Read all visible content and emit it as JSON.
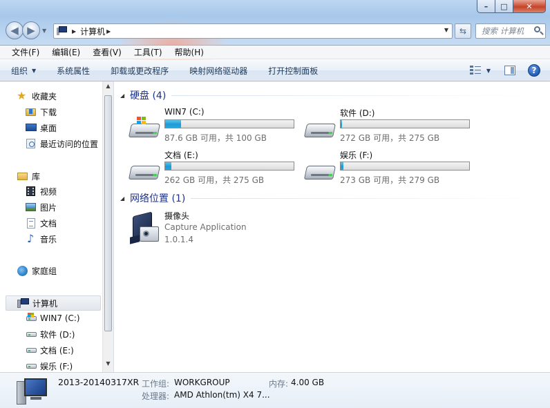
{
  "window": {
    "minimize_glyph": "–",
    "maximize_glyph": "□",
    "close_glyph": "✕"
  },
  "nav": {
    "back_glyph": "◀",
    "forward_glyph": "▶"
  },
  "address": {
    "path": "计算机",
    "separator_glyph": "▶"
  },
  "search": {
    "placeholder": "搜索 计算机"
  },
  "menu": [
    "文件(F)",
    "编辑(E)",
    "查看(V)",
    "工具(T)",
    "帮助(H)"
  ],
  "commands": {
    "organize": "组织",
    "system_properties": "系统属性",
    "uninstall": "卸载或更改程序",
    "map_drive": "映射网络驱动器",
    "control_panel": "打开控制面板",
    "help_glyph": "?"
  },
  "sidebar": {
    "favorites": {
      "label": "收藏夹",
      "items": [
        "下载",
        "桌面",
        "最近访问的位置"
      ]
    },
    "libraries": {
      "label": "库",
      "items": [
        "视频",
        "图片",
        "文档",
        "音乐"
      ]
    },
    "homegroup": "家庭组",
    "computer": {
      "label": "计算机",
      "items": [
        "WIN7 (C:)",
        "软件 (D:)",
        "文档 (E:)",
        "娱乐 (F:)"
      ]
    }
  },
  "drives_group": {
    "title": "硬盘 (4)",
    "drives": [
      {
        "name": "WIN7 (C:)",
        "free_text": "87.6 GB 可用，共 100 GB",
        "used_percent": 12.4,
        "system": true
      },
      {
        "name": "软件 (D:)",
        "free_text": "272 GB 可用，共 275 GB",
        "used_percent": 1.1,
        "system": false
      },
      {
        "name": "文档 (E:)",
        "free_text": "262 GB 可用，共 275 GB",
        "used_percent": 4.7,
        "system": false
      },
      {
        "name": "娱乐 (F:)",
        "free_text": "273 GB 可用，共 279 GB",
        "used_percent": 2.2,
        "system": false
      }
    ]
  },
  "network_group": {
    "title": "网络位置 (1)",
    "device": {
      "name": "摄像头",
      "app": "Capture Application",
      "version": "1.0.1.4"
    }
  },
  "details": {
    "computer_name": "2013-20140317XR",
    "workgroup_label": "工作组:",
    "workgroup_value": "WORKGROUP",
    "memory_label": "内存:",
    "memory_value": "4.00 GB",
    "processor_label": "处理器:",
    "processor_value": "AMD Athlon(tm) X4 7..."
  },
  "colors": {
    "group_title": "#1e3287",
    "bar_fill": "#1c9bd6",
    "command_text": "#1e395b"
  }
}
